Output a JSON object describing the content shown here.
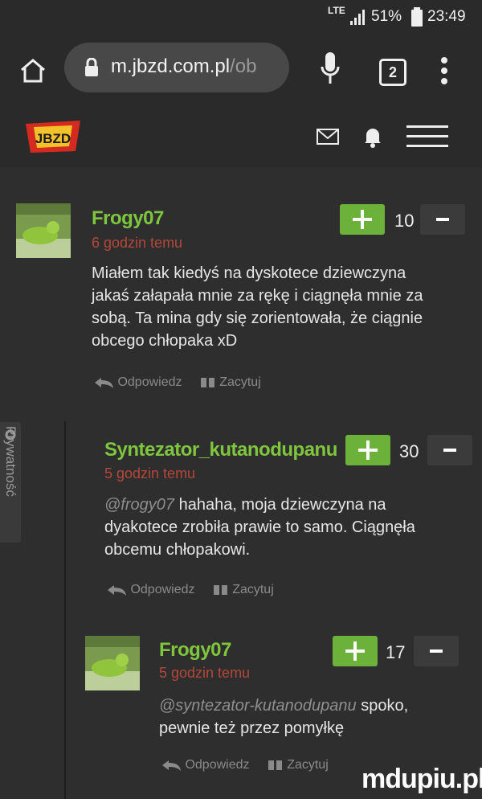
{
  "status_bar": {
    "network": "LTE",
    "battery": "51%",
    "time": "23:49"
  },
  "browser": {
    "url_host": "m.jbzd.com.pl",
    "url_path": "/ob",
    "tab_count": "2"
  },
  "site": {
    "logo_text": "JBZD"
  },
  "side_tab": {
    "label": "Prywatność"
  },
  "comments": [
    {
      "user": "Frogy07",
      "time": "6 godzin temu",
      "score": "10",
      "mention": "",
      "text": "Miałem tak kiedyś na dyskotece dziewczyna jakaś załapała mnie za rękę i ciągnęła mnie za sobą. Ta mina gdy się zorientowała, że ciągnie obcego chłopaka xD",
      "reply": "Odpowiedz",
      "quote": "Zacytuj"
    },
    {
      "user": "Syntezator_kutanodupanu",
      "time": "5 godzin temu",
      "score": "30",
      "mention": "@frogy07",
      "text": "hahaha, moja dziewczyna na dyakotece zrobiła prawie to samo. Ciągnęła obcemu chłopakowi.",
      "reply": "Odpowiedz",
      "quote": "Zacytuj"
    },
    {
      "user": "Frogy07",
      "time": "5 godzin temu",
      "score": "17",
      "mention": "@syntezator-kutanodupanu",
      "text": "spoko, pewnie też przez pomyłkę",
      "reply": "Odpowiedz",
      "quote": "Zacytuj"
    }
  ],
  "watermark": "mdupiu.pl"
}
